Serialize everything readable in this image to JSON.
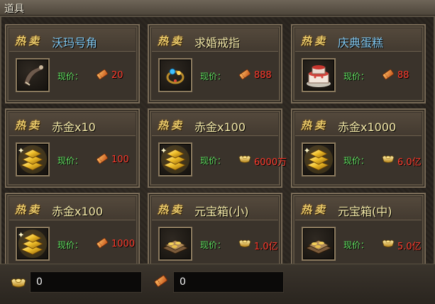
{
  "window": {
    "title": "道具"
  },
  "labels": {
    "hot": "热卖",
    "price_label": "现价："
  },
  "items": [
    {
      "name": "沃玛号角",
      "name_color": "blue",
      "currency": "ticket-icon",
      "price": "20",
      "icon": "horn-icon"
    },
    {
      "name": "求婚戒指",
      "name_color": "yellow",
      "currency": "ticket-icon",
      "price": "888",
      "icon": "ring-icon"
    },
    {
      "name": "庆典蛋糕",
      "name_color": "blue",
      "currency": "ticket-icon",
      "price": "88",
      "icon": "cake-icon"
    },
    {
      "name": "赤金x10",
      "name_color": "yellow",
      "currency": "ticket-icon",
      "price": "100",
      "icon": "gold-bars-icon"
    },
    {
      "name": "赤金x100",
      "name_color": "yellow",
      "currency": "ingot-icon",
      "price": "6000万",
      "icon": "gold-bars-icon"
    },
    {
      "name": "赤金x1000",
      "name_color": "yellow",
      "currency": "ingot-icon",
      "price": "6.0亿",
      "icon": "gold-bars-icon"
    },
    {
      "name": "赤金x100",
      "name_color": "yellow",
      "currency": "ticket-icon",
      "price": "1000",
      "icon": "gold-bars-icon"
    },
    {
      "name": "元宝箱(小)",
      "name_color": "yellow",
      "currency": "ingot-icon",
      "price": "1.0亿",
      "icon": "ingot-chest-icon"
    },
    {
      "name": "元宝箱(中)",
      "name_color": "yellow",
      "currency": "ingot-icon",
      "price": "5.0亿",
      "icon": "ingot-chest-icon"
    }
  ],
  "wallet": {
    "ingot_icon": "ingot-icon",
    "ingot_amount": "0",
    "ticket_icon": "ticket-icon",
    "ticket_amount": "0"
  },
  "colors": {
    "hot_label": "#e9c96a",
    "price_label": "#5fe05f",
    "price": "#ff3a2c",
    "name_blue": "#82c8f0",
    "name_yellow": "#f4e9a8"
  }
}
